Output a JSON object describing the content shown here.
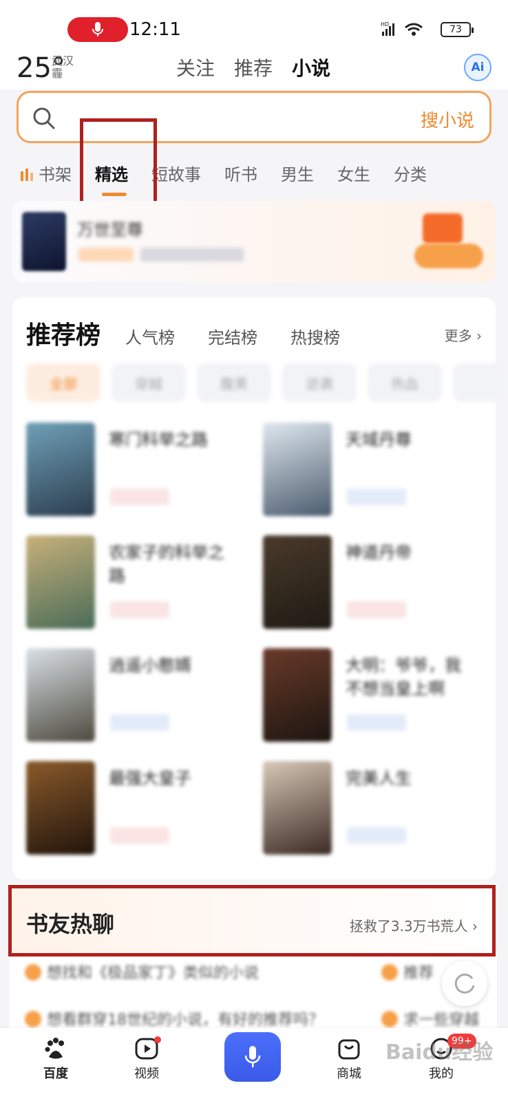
{
  "status_bar": {
    "time": "12:11",
    "battery": "73",
    "network": "HD"
  },
  "header": {
    "temperature": "25°",
    "city": "武汉",
    "weather": "霾",
    "tabs": [
      "关注",
      "推荐",
      "小说"
    ],
    "active_tab": "小说",
    "ai_label": "Ai"
  },
  "search": {
    "button_label": "搜小说"
  },
  "categories": [
    "书架",
    "精选",
    "短故事",
    "听书",
    "男生",
    "女生",
    "分类"
  ],
  "active_category": "精选",
  "banner": {
    "title": "万世至尊"
  },
  "ranking": {
    "title": "推荐榜",
    "tabs": [
      "人气榜",
      "完结榜",
      "热搜榜"
    ],
    "more": "更多",
    "chips": [
      "全部",
      "穿越",
      "腹黑",
      "逆袭",
      "热血"
    ],
    "books": [
      {
        "name": "寒门科举之路"
      },
      {
        "name": "天域丹尊"
      },
      {
        "name": "农家子的科举之路"
      },
      {
        "name": "神道丹帝"
      },
      {
        "name": "逍遥小憨婿"
      },
      {
        "name": "大明：爷爷，我不想当皇上啊"
      },
      {
        "name": "最强大皇子"
      },
      {
        "name": "完美人生"
      }
    ]
  },
  "discussion": {
    "title": "书友热聊",
    "subtitle": "拯救了3.3万书荒人",
    "questions": [
      "想找和《极品家丁》类似的小说",
      "推荐",
      "想看群穿18世纪的小说，有好的推荐吗？",
      "求一些穿越"
    ]
  },
  "bottom_nav": {
    "items": [
      "百度",
      "视频",
      "商城",
      "我的"
    ],
    "badge": "99+",
    "active": "百度"
  },
  "watermark": "Baidu经验",
  "colors": {
    "accent": "#f08a2e",
    "highlight_box": "#b0201e",
    "voice_button": "#4b6ffb"
  }
}
